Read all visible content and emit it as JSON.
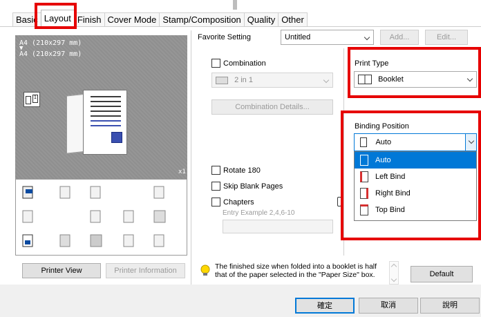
{
  "tabs": [
    {
      "label": "Basic",
      "active": false
    },
    {
      "label": "Layout",
      "active": true
    },
    {
      "label": "Finish",
      "active": false
    },
    {
      "label": "Cover Mode",
      "active": false
    },
    {
      "label": "Stamp/Composition",
      "active": false
    },
    {
      "label": "Quality",
      "active": false
    },
    {
      "label": "Other",
      "active": false
    }
  ],
  "preview": {
    "line1": "A4 (210x297 mm)",
    "arrow": "▼",
    "line2": "A4 (210x297 mm)",
    "count": "x1",
    "mini_label": "1"
  },
  "favorite": {
    "label": "Favorite Setting",
    "value": "Untitled",
    "add_label": "Add...",
    "edit_label": "Edit..."
  },
  "combination": {
    "label": "Combination",
    "checked": false,
    "value": "2 in 1",
    "details_label": "Combination Details..."
  },
  "print_type": {
    "label": "Print Type",
    "value": "Booklet"
  },
  "binding": {
    "label": "Binding Position",
    "value": "Auto",
    "options": [
      "Auto",
      "Left Bind",
      "Right Bind",
      "Top Bind"
    ],
    "selected_index": 0
  },
  "options": {
    "rotate": "Rotate 180",
    "skip_blank": "Skip Blank Pages",
    "chapters": "Chapters",
    "chapters_placeholder": "Entry Example 2,4,6-10"
  },
  "buttons": {
    "printer_view": "Printer View",
    "printer_info": "Printer Information",
    "default": "Default",
    "ok": "確定",
    "cancel": "取消",
    "help": "說明"
  },
  "hint": {
    "text": "The finished size when folded into a booklet is half that of the paper selected in the \"Paper Size\" box."
  },
  "colors": {
    "highlight": "#e60000",
    "selection": "#0078d7"
  }
}
